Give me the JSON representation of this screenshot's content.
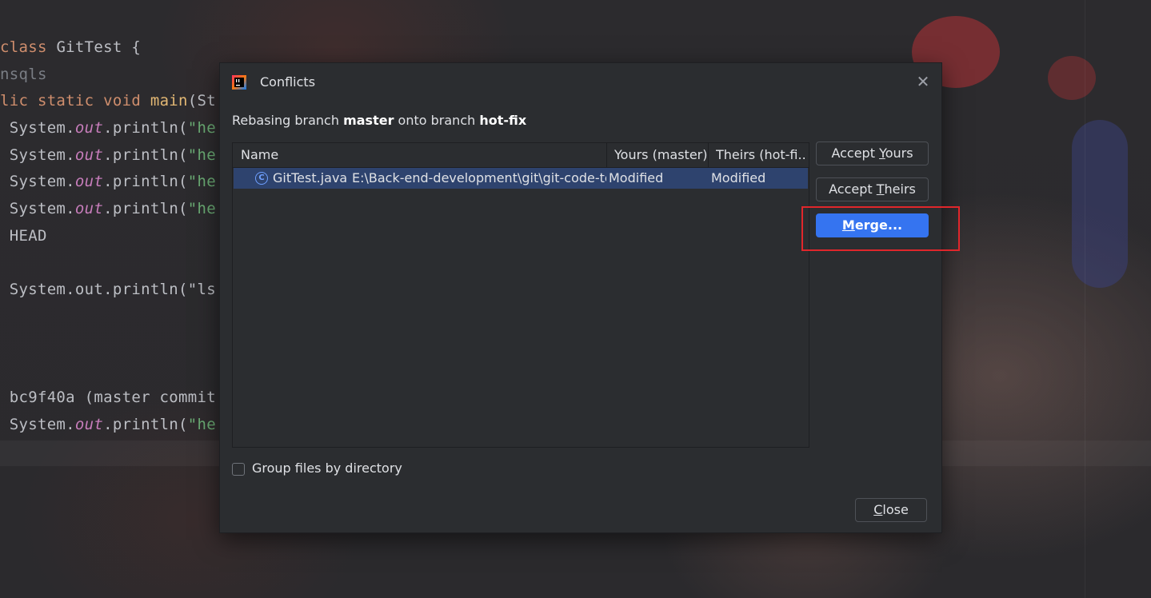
{
  "editor": {
    "lines": [
      {
        "parts": [
          {
            "t": "class ",
            "c": "kw"
          },
          {
            "t": "GitTest {",
            "c": ""
          }
        ]
      },
      {
        "parts": [
          {
            "t": "nsqls",
            "c": "dim"
          }
        ]
      },
      {
        "parts": [
          {
            "t": "lic static void ",
            "c": "kw"
          },
          {
            "t": "main",
            "c": "mt"
          },
          {
            "t": "(St",
            "c": ""
          }
        ]
      },
      {
        "parts": [
          {
            "t": " System.",
            "c": ""
          },
          {
            "t": "out",
            "c": "it"
          },
          {
            "t": ".println(",
            "c": ""
          },
          {
            "t": "\"he",
            "c": "st"
          }
        ]
      },
      {
        "parts": [
          {
            "t": " System.",
            "c": ""
          },
          {
            "t": "out",
            "c": "it"
          },
          {
            "t": ".println(",
            "c": ""
          },
          {
            "t": "\"he",
            "c": "st"
          }
        ]
      },
      {
        "parts": [
          {
            "t": " System.",
            "c": ""
          },
          {
            "t": "out",
            "c": "it"
          },
          {
            "t": ".println(",
            "c": ""
          },
          {
            "t": "\"he",
            "c": "st"
          }
        ]
      },
      {
        "parts": [
          {
            "t": " System.",
            "c": ""
          },
          {
            "t": "out",
            "c": "it"
          },
          {
            "t": ".println(",
            "c": ""
          },
          {
            "t": "\"he",
            "c": "st"
          }
        ]
      },
      {
        "parts": [
          {
            "t": " HEAD",
            "c": ""
          }
        ]
      },
      {
        "parts": [
          {
            "t": " System.out.println(\"ls",
            "c": ""
          }
        ]
      },
      {
        "parts": [
          {
            "t": " bc9f40a (master commit",
            "c": ""
          }
        ]
      },
      {
        "parts": [
          {
            "t": " System.",
            "c": ""
          },
          {
            "t": "out",
            "c": "it"
          },
          {
            "t": ".println(",
            "c": ""
          },
          {
            "t": "\"he",
            "c": "st"
          }
        ]
      }
    ]
  },
  "dialog": {
    "title": "Conflicts",
    "subtitle": {
      "prefix": "Rebasing branch ",
      "branch_from": "master",
      "middle": " onto branch ",
      "branch_to": "hot-fix"
    },
    "table": {
      "columns": [
        "Name",
        "Yours (master)",
        "Theirs (hot-fi..."
      ],
      "rows": [
        {
          "file": "GitTest.java",
          "path": "E:\\Back-end-development\\git\\git-code-te",
          "yours": "Modified",
          "theirs": "Modified",
          "icon": "class-file-icon"
        }
      ]
    },
    "buttons": {
      "accept_yours": {
        "before": "Accept ",
        "mnemonic": "Y",
        "after": "ours"
      },
      "accept_theirs": {
        "before": "Accept ",
        "mnemonic": "T",
        "after": "heirs"
      },
      "merge": {
        "before": "",
        "mnemonic": "M",
        "after": "erge..."
      },
      "close": {
        "before": "",
        "mnemonic": "C",
        "after": "lose"
      }
    },
    "group_files_label": "Group files by directory",
    "group_files_checked": false,
    "colors": {
      "primary": "#3574f0",
      "highlight": "#e0262b",
      "selection": "#2e436e"
    }
  }
}
